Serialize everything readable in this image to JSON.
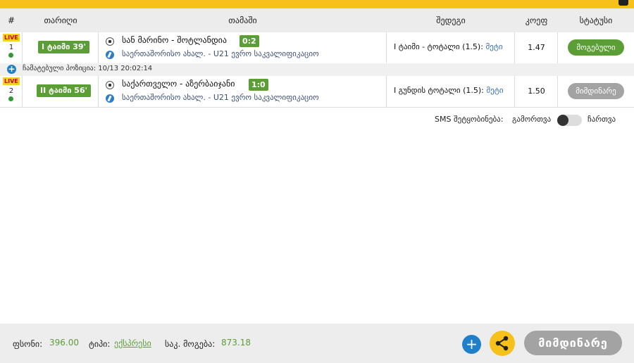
{
  "header": {
    "col_num": "#",
    "col_date": "თარიღი",
    "col_match": "თამაში",
    "col_bet": "შედეგი",
    "col_odds": "კოეფ",
    "col_status": "სტატუსი"
  },
  "rows": [
    {
      "live": "LIVE",
      "num": "1",
      "time": "I ტაიმი 39'",
      "match": "სან მარინო - შოტლანდია",
      "score": "0:2",
      "league": "საერთაშორისო ახალ. - U21 ევრო საკვალიფიკაციო",
      "bet_label": "I ტაიმი - ტოტალი (1.5):",
      "bet_pick": "მეტი",
      "odds": "1.47",
      "status": "მოგებული"
    },
    {
      "live": "LIVE",
      "num": "2",
      "time": "II ტაიმი 56'",
      "match": "საქართველო - აზერბაიჯანი",
      "score": "1:0",
      "league": "საერთაშორისო ახალ. - U21 ევრო საკვალიფიკაციო",
      "bet_label": "I გუნდის ტოტალი (1.5):",
      "bet_pick": "მეტი",
      "odds": "1.50",
      "status": "მიმდინარე"
    }
  ],
  "changed_position": "ჩამატებული პოზიცია: 10/13 20:02:14",
  "sms": {
    "label": "SMS შეტყობინება:",
    "off_label": "გამორთვა",
    "on_label": "ჩართვა",
    "enabled": false
  },
  "footer": {
    "stake_label": "ფსონი:",
    "stake_value": "396.00",
    "type_label": "ტიპი:",
    "type_value": "ექსპრესი",
    "win_label": "საკ. მოგება:",
    "win_value": "873.18",
    "current_button": "მიმდინარე"
  },
  "colors": {
    "accent_yellow": "#f5c11a",
    "green": "#5b9e35",
    "blue": "#1f7fc8",
    "grey_button": "#a3a3a3"
  },
  "icons": {
    "sport": "soccer-ball-icon",
    "league": "league-icon",
    "add": "plus-icon",
    "share": "share-icon"
  }
}
